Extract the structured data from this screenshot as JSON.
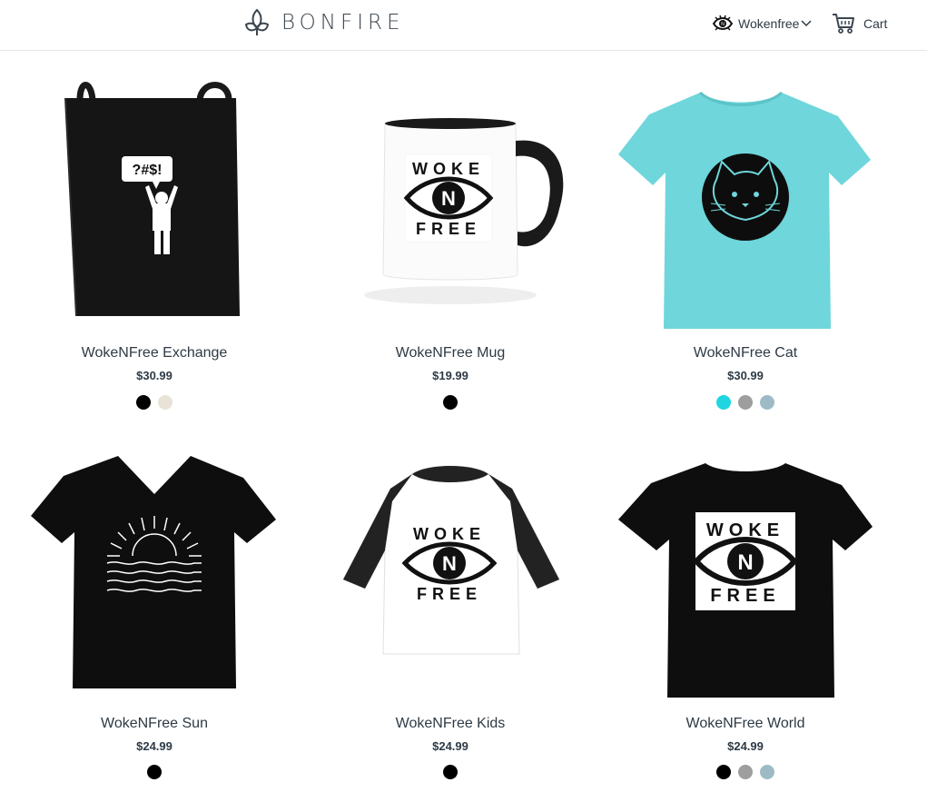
{
  "header": {
    "brand": "BONFIRE",
    "store_name": "Wokenfree",
    "cart_label": "Cart"
  },
  "products": [
    {
      "name": "WokeNFree Exchange",
      "price": "$30.99",
      "swatches": [
        "#000000",
        "#e8e3d6"
      ],
      "garment_color": "#111111"
    },
    {
      "name": "WokeNFree Mug",
      "price": "$19.99",
      "swatches": [
        "#000000"
      ],
      "garment_color": "#ffffff"
    },
    {
      "name": "WokeNFree Cat",
      "price": "$30.99",
      "swatches": [
        "#1fd6e0",
        "#9e9e9e",
        "#9fbac7"
      ],
      "garment_color": "#6fd6db"
    },
    {
      "name": "WokeNFree Sun",
      "price": "$24.99",
      "swatches": [
        "#000000"
      ],
      "garment_color": "#0a0a0a"
    },
    {
      "name": "WokeNFree Kids",
      "price": "$24.99",
      "swatches": [
        "#000000"
      ],
      "garment_color": "#ffffff"
    },
    {
      "name": "WokeNFree World",
      "price": "$24.99",
      "swatches": [
        "#000000",
        "#9e9e9e",
        "#9fbac7"
      ],
      "garment_color": "#0a0a0a"
    }
  ],
  "artwork": {
    "speech_bubble": "?#$!",
    "woke": "WOKE",
    "free": "FREE",
    "n": "N"
  }
}
